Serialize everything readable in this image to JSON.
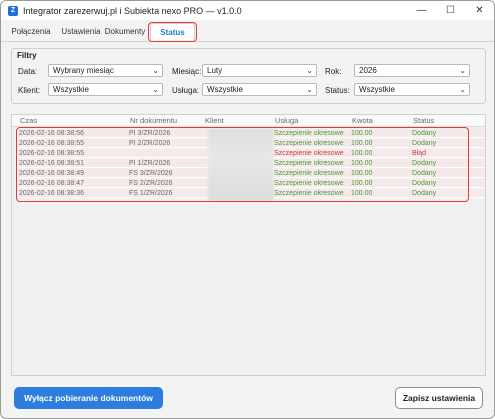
{
  "window": {
    "title": "Integrator zarezerwuj.pl i Subiekta nexo PRO — v1.0.0",
    "app_icon_letter": "Z",
    "controls": {
      "minimize": "—",
      "maximize": "☐",
      "close": "✕"
    }
  },
  "tabs": [
    {
      "label": "Połączenia",
      "active": false
    },
    {
      "label": "Ustawienia",
      "active": false
    },
    {
      "label": "Dokumenty",
      "active": false
    },
    {
      "label": "Status",
      "active": true
    }
  ],
  "filters": {
    "title": "Filtry",
    "data": {
      "label": "Data:",
      "value": "Wybrany miesiąc"
    },
    "miesiac": {
      "label": "Miesiąc:",
      "value": "Luty"
    },
    "rok": {
      "label": "Rok:",
      "value": "2026"
    },
    "klient": {
      "label": "Klient:",
      "value": "Wszystkie"
    },
    "usluga": {
      "label": "Usługa:",
      "value": "Wszystkie"
    },
    "status": {
      "label": "Status:",
      "value": "Wszystkie"
    }
  },
  "table": {
    "columns": [
      "Czas",
      "Nr dokumentu",
      "Klient",
      "Usługa",
      "Kwota",
      "Status"
    ],
    "rows": [
      {
        "time": "2026-02-16 08:38:56",
        "doc": "PI 3/ZR/2026",
        "client": "",
        "service": "Szczepienie okresowe",
        "amount": "100.00",
        "status": "Dodany",
        "error": false
      },
      {
        "time": "2026-02-16 08:38:55",
        "doc": "PI 2/ZR/2026",
        "client": "",
        "service": "Szczepienie okresowe",
        "amount": "100.00",
        "status": "Dodany",
        "error": false
      },
      {
        "time": "2026-02-16 08:38:55",
        "doc": "",
        "client": "",
        "service": "Szczepienie okresowe",
        "amount": "100.00",
        "status": "Błąd",
        "error": true
      },
      {
        "time": "2026-02-16 08:38:51",
        "doc": "PI 1/ZR/2026",
        "client": "",
        "service": "Szczepienie okresowe",
        "amount": "100.00",
        "status": "Dodany",
        "error": false
      },
      {
        "time": "2026-02-16 08:38:49",
        "doc": "FS 3/ZR/2026",
        "client": "",
        "service": "Szczepienie okresowe",
        "amount": "100.00",
        "status": "Dodany",
        "error": false
      },
      {
        "time": "2026-02-16 08:38:47",
        "doc": "FS 2/ZR/2026",
        "client": "",
        "service": "Szczepienie okresowe",
        "amount": "100.00",
        "status": "Dodany",
        "error": false
      },
      {
        "time": "2026-02-16 08:38:36",
        "doc": "FS 1/ZR/2026",
        "client": "",
        "service": "Szczepienie okresowe",
        "amount": "100.00",
        "status": "Dodany",
        "error": false
      }
    ]
  },
  "footer": {
    "primary_button": "Wyłącz pobieranie dokumentów",
    "save_button": "Zapisz ustawienia"
  },
  "colors": {
    "accent": "#2d7de0",
    "highlight": "#e23a3a",
    "ok": "#4a9a3c",
    "error": "#d13a3a"
  }
}
